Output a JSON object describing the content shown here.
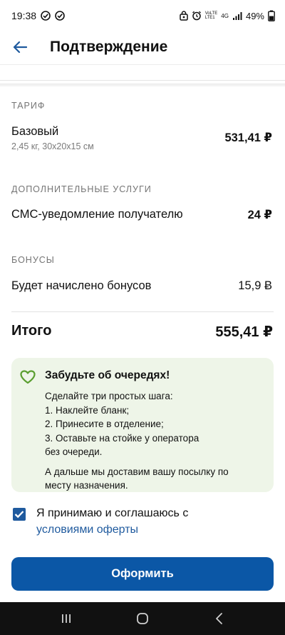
{
  "status_bar": {
    "time": "19:38",
    "battery": "49%",
    "network_lines": [
      "VoLTE",
      "LTE1",
      "4G"
    ]
  },
  "header": {
    "title": "Подтверждение"
  },
  "tariff": {
    "section_label": "ТАРИФ",
    "name": "Базовый",
    "details": "2,45 кг, 30x20x15 см",
    "price": "531,41 ₽"
  },
  "extra_services": {
    "section_label": "ДОПОЛНИТЕЛЬНЫЕ УСЛУГИ",
    "items": [
      {
        "name": "СМС-уведомление получателю",
        "price": "24 ₽"
      }
    ]
  },
  "bonuses": {
    "section_label": "БОНУСЫ",
    "text": "Будет начислено бонусов",
    "value": "15,9 Ƀ"
  },
  "total": {
    "label": "Итого",
    "value": "555,41 ₽"
  },
  "info_card": {
    "title": "Забудьте об очередях!",
    "lines": [
      "Сделайте три простых шага:",
      "1. Наклейте бланк;",
      "2. Принесите в отделение;",
      "3. Оставьте на стойке у оператора",
      "без очереди."
    ],
    "paragraph2_lines": [
      "А дальше мы доставим вашу посылку по",
      "месту назначения."
    ],
    "icon": "heart-outline-icon",
    "accent_color": "#5a9e2f"
  },
  "agreement": {
    "checked": true,
    "text": "Я принимаю и соглашаюсь с",
    "link_text": "условиями оферты"
  },
  "submit": {
    "label": "Оформить",
    "color": "#0b57a6"
  },
  "nav": {
    "icons": [
      "recent-apps-icon",
      "home-icon",
      "back-nav-icon"
    ]
  }
}
